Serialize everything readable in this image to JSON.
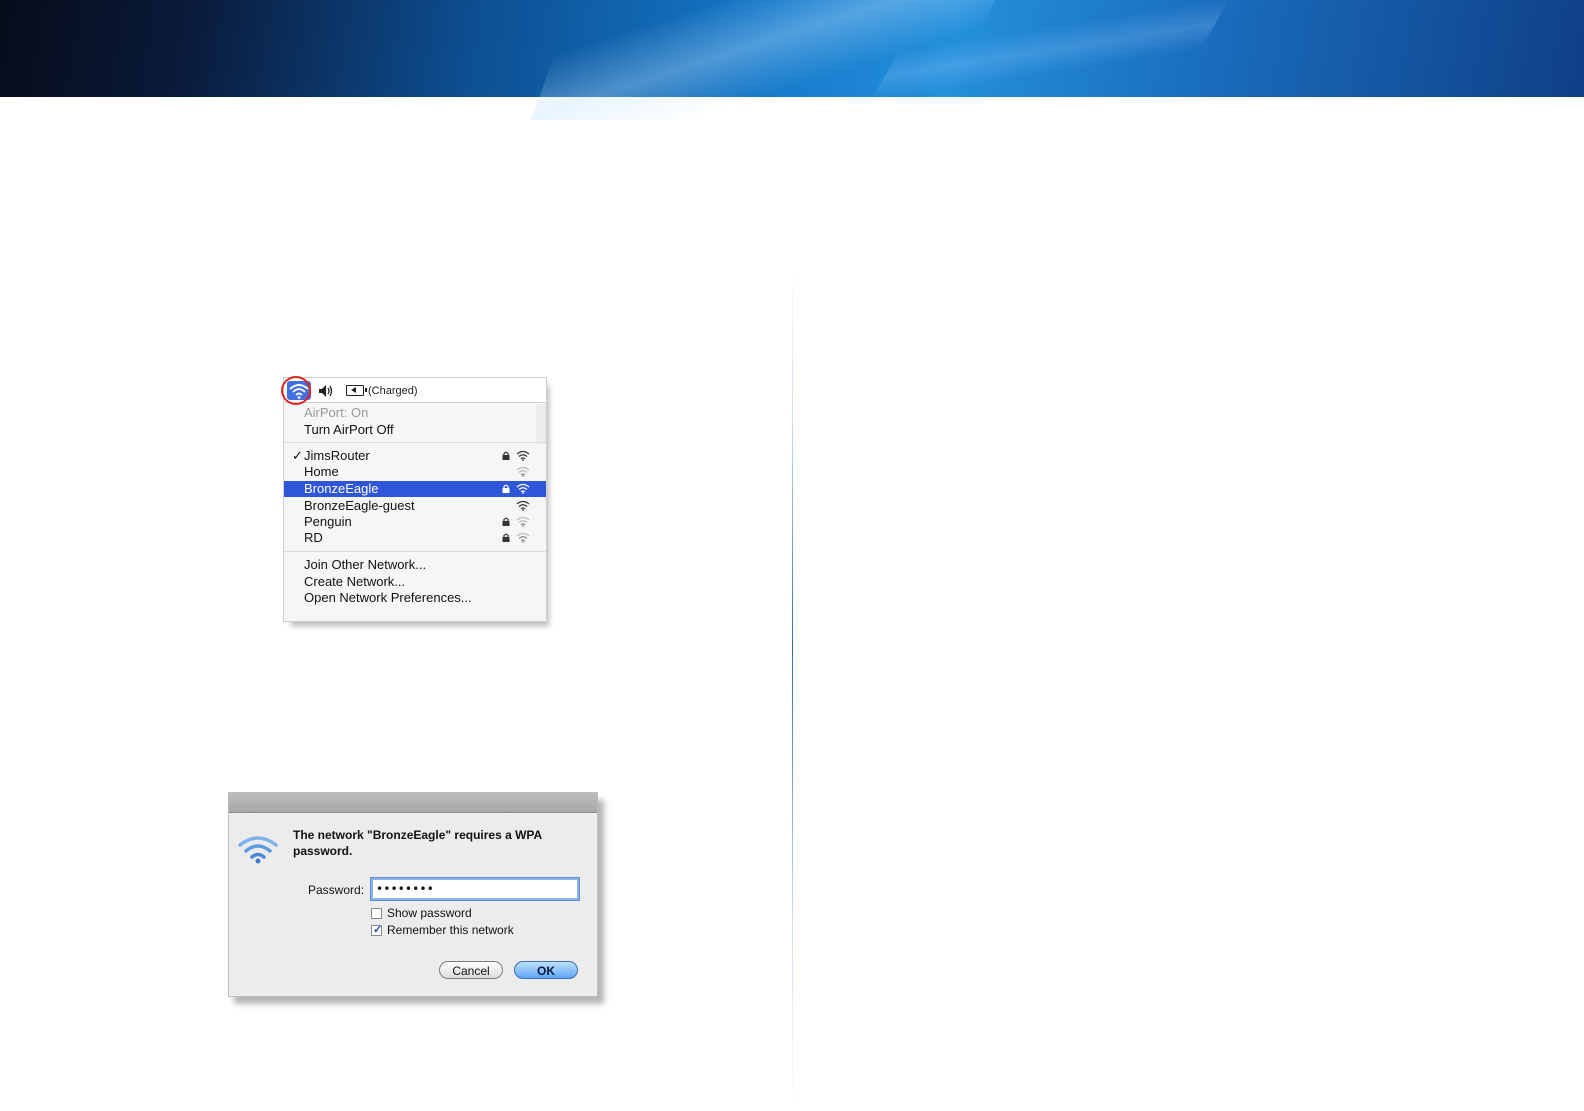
{
  "menu": {
    "menubar": {
      "battery_status": "(Charged)"
    },
    "airport_status": "AirPort: On",
    "toggle_airport": "Turn AirPort Off",
    "networks": [
      {
        "name": "JimsRouter",
        "checked": true,
        "locked": true,
        "selected": false
      },
      {
        "name": "Home",
        "checked": false,
        "locked": false,
        "selected": false
      },
      {
        "name": "BronzeEagle",
        "checked": false,
        "locked": true,
        "selected": true
      },
      {
        "name": "BronzeEagle-guest",
        "checked": false,
        "locked": false,
        "selected": false
      },
      {
        "name": "Penguin",
        "checked": false,
        "locked": true,
        "selected": false
      },
      {
        "name": "RD",
        "checked": false,
        "locked": true,
        "selected": false
      }
    ],
    "checkmark": "✓",
    "actions": {
      "join_other": "Join Other Network...",
      "create": "Create Network...",
      "open_prefs": "Open Network Preferences..."
    }
  },
  "dialog": {
    "message": "The network \"BronzeEagle\" requires a WPA password.",
    "password_label": "Password:",
    "password_value": "••••••••",
    "show_password_label": "Show password",
    "show_password_checked": false,
    "remember_label": "Remember this network",
    "remember_checked": true,
    "cancel_label": "Cancel",
    "ok_label": "OK"
  },
  "colors": {
    "selection": "#2f56d8",
    "highlight_ring": "#e32222",
    "ok_button": "#5ea7f2"
  }
}
